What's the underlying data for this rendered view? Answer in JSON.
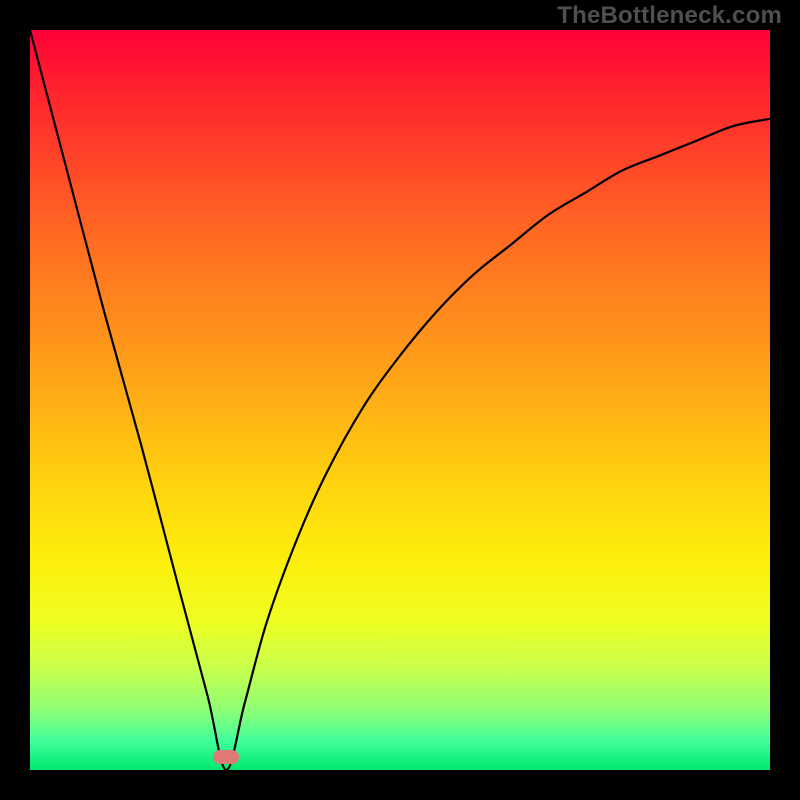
{
  "watermark": "TheBottleneck.com",
  "gradient_colors": {
    "top": "#ff0038",
    "bottom": "#00e86f"
  },
  "marker": {
    "color": "#df7b77",
    "x_fraction": 0.265,
    "y_fraction": 0.982
  },
  "chart_data": {
    "type": "line",
    "title": "",
    "xlabel": "",
    "ylabel": "",
    "xlim": [
      0,
      100
    ],
    "ylim": [
      0,
      100
    ],
    "grid": false,
    "legend": false,
    "series": [
      {
        "name": "bottleneck-curve",
        "x": [
          0,
          5,
          10,
          15,
          20,
          24,
          26.5,
          29,
          32,
          36,
          40,
          45,
          50,
          55,
          60,
          65,
          70,
          75,
          80,
          85,
          90,
          95,
          100
        ],
        "values": [
          100,
          81,
          62,
          44,
          25,
          10,
          0,
          9,
          20,
          31,
          40,
          49,
          56,
          62,
          67,
          71,
          75,
          78,
          81,
          83,
          85,
          87,
          88
        ]
      }
    ],
    "annotations": [
      {
        "type": "marker",
        "x": 26.5,
        "y": 0,
        "shape": "pill",
        "color": "#df7b77"
      }
    ]
  }
}
